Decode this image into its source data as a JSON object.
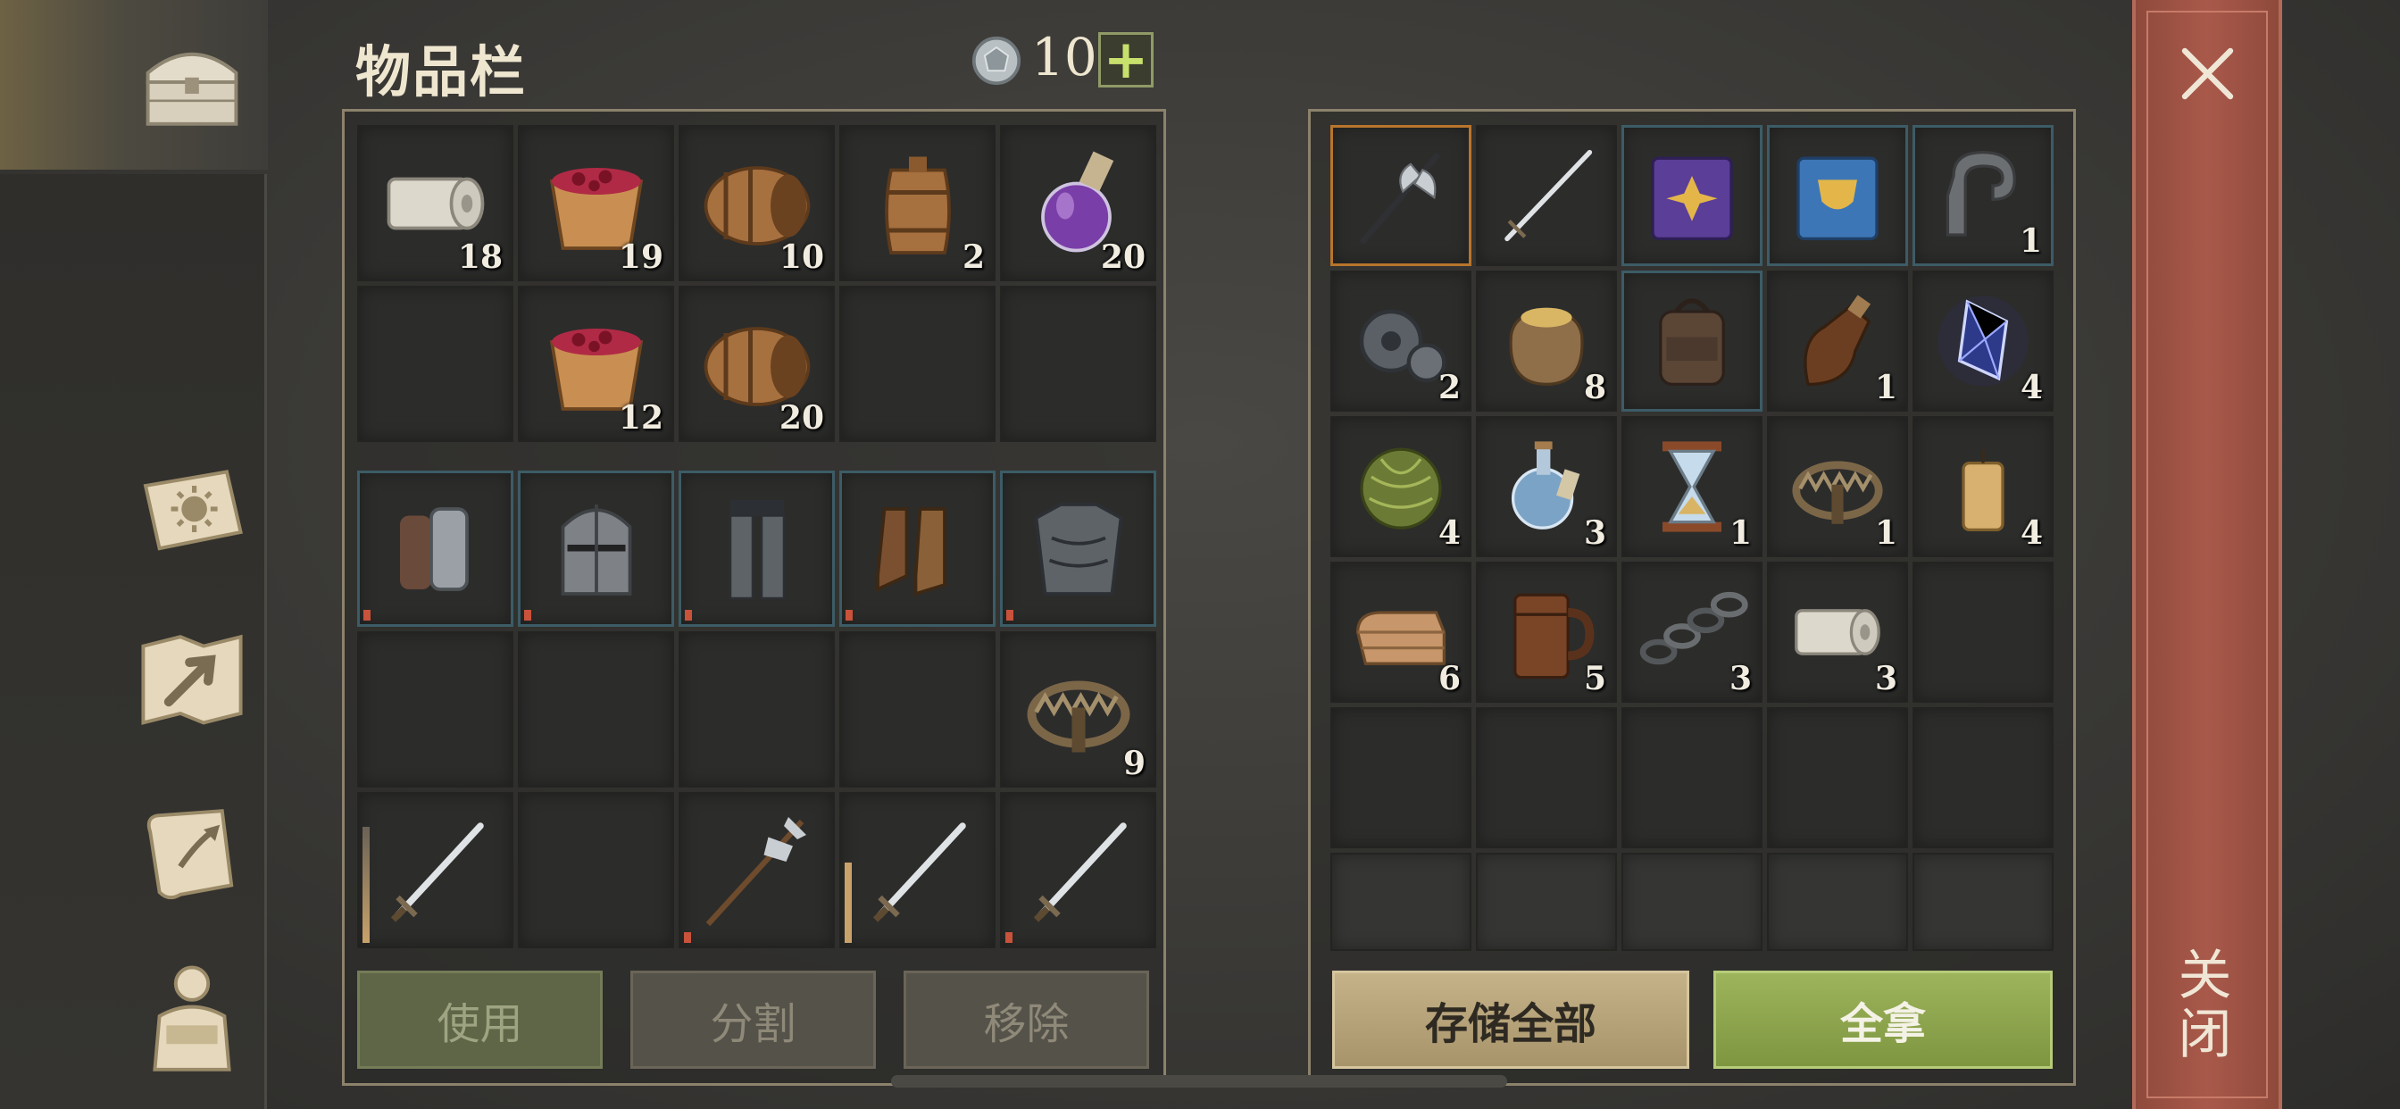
{
  "header": {
    "title": "物品栏",
    "currency_icon": "silver-coin-icon",
    "currency_count": "10",
    "add_label": "+"
  },
  "sidebar": {
    "items": [
      {
        "name": "chest-icon",
        "active": true
      },
      {
        "name": "sun-book-icon",
        "active": false
      },
      {
        "name": "crafting-map-icon",
        "active": false
      },
      {
        "name": "quest-scroll-icon",
        "active": false
      },
      {
        "name": "character-icon",
        "active": false
      }
    ]
  },
  "inventory": {
    "consumables": [
      {
        "icon": "cloth-roll-icon",
        "count": "18"
      },
      {
        "icon": "berry-bucket-icon",
        "count": "19"
      },
      {
        "icon": "barrel-side-icon",
        "count": "10"
      },
      {
        "icon": "barrel-upright-icon",
        "count": "2"
      },
      {
        "icon": "purple-potion-icon",
        "count": "20"
      },
      {
        "icon": "",
        "count": ""
      },
      {
        "icon": "berry-bucket-icon",
        "count": "12"
      },
      {
        "icon": "barrel-side-icon",
        "count": "20"
      },
      {
        "icon": "",
        "count": ""
      },
      {
        "icon": "",
        "count": ""
      }
    ],
    "equipment": [
      {
        "icon": "chain-gloves-icon",
        "count": ""
      },
      {
        "icon": "great-helm-icon",
        "count": ""
      },
      {
        "icon": "chain-leggings-icon",
        "count": ""
      },
      {
        "icon": "leather-boots-icon",
        "count": ""
      },
      {
        "icon": "scale-armor-icon",
        "count": ""
      }
    ],
    "bag": [
      {
        "icon": "",
        "count": ""
      },
      {
        "icon": "",
        "count": ""
      },
      {
        "icon": "",
        "count": ""
      },
      {
        "icon": "",
        "count": ""
      },
      {
        "icon": "bear-trap-icon",
        "count": "9"
      }
    ],
    "weapons": [
      {
        "icon": "sword-icon",
        "count": ""
      },
      {
        "icon": "",
        "count": ""
      },
      {
        "icon": "halberd-icon",
        "count": ""
      },
      {
        "icon": "sword-icon",
        "count": ""
      },
      {
        "icon": "sword-icon",
        "count": ""
      }
    ]
  },
  "container": {
    "slots": [
      {
        "icon": "battle-axe-icon",
        "count": ""
      },
      {
        "icon": "longsword-icon",
        "count": ""
      },
      {
        "icon": "purple-book-icon",
        "count": ""
      },
      {
        "icon": "blue-book-icon",
        "count": ""
      },
      {
        "icon": "metal-clamp-icon",
        "count": "1"
      },
      {
        "icon": "gears-icon",
        "count": "2"
      },
      {
        "icon": "grain-sack-icon",
        "count": "8"
      },
      {
        "icon": "backpack-icon",
        "count": ""
      },
      {
        "icon": "leather-flask-icon",
        "count": "1"
      },
      {
        "icon": "crystal-icon",
        "count": "4"
      },
      {
        "icon": "herb-ball-icon",
        "count": "4"
      },
      {
        "icon": "water-bottle-icon",
        "count": "3"
      },
      {
        "icon": "hourglass-icon",
        "count": "1"
      },
      {
        "icon": "bear-trap-icon",
        "count": "1"
      },
      {
        "icon": "candle-icon",
        "count": "4"
      },
      {
        "icon": "folded-cloth-icon",
        "count": "6"
      },
      {
        "icon": "wooden-mug-icon",
        "count": "5"
      },
      {
        "icon": "chain-icon",
        "count": "3"
      },
      {
        "icon": "cloth-roll-icon",
        "count": "3"
      },
      {
        "icon": "",
        "count": ""
      }
    ]
  },
  "actions": {
    "use": "使用",
    "split": "分割",
    "remove": "移除",
    "store_all": "存储全部",
    "take_all": "全拿"
  },
  "close": {
    "label": "关闭",
    "icon": "close-icon"
  }
}
